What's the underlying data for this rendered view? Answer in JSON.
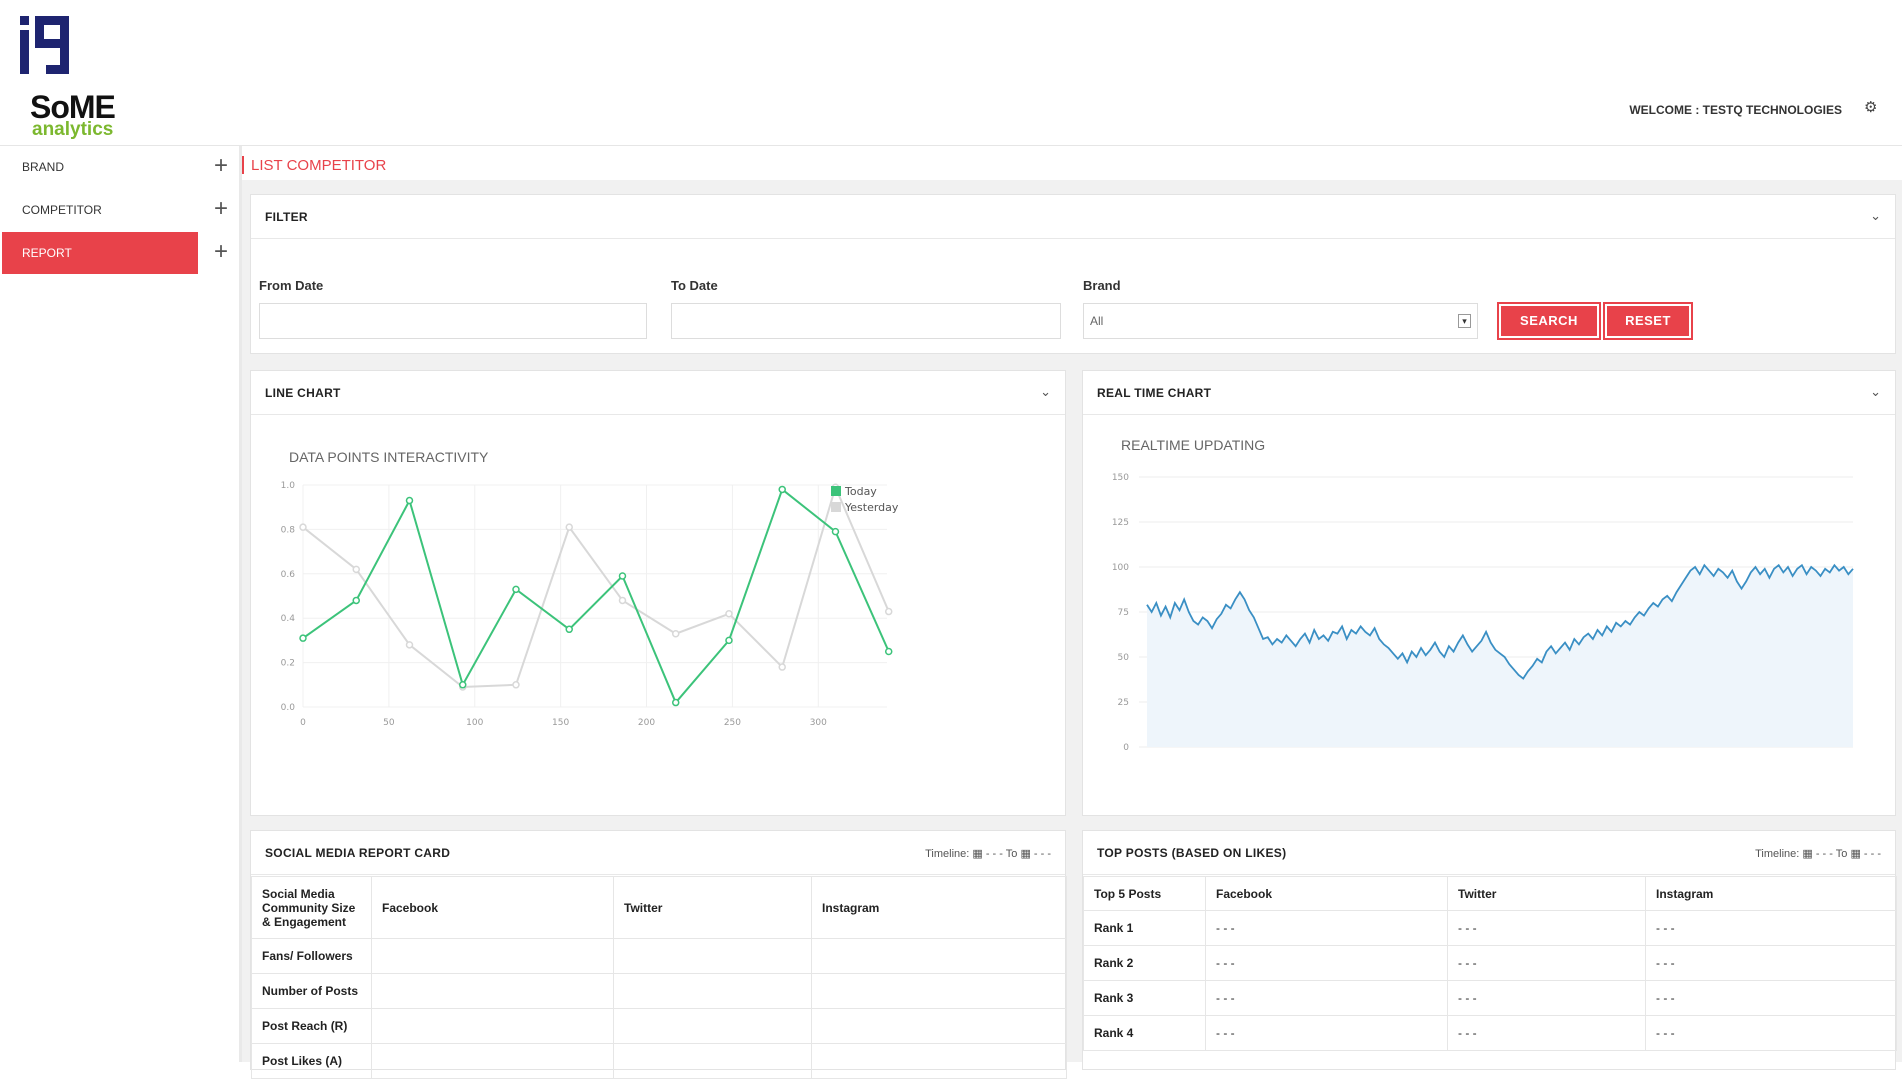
{
  "header": {
    "iq_logo": "iq",
    "brand_logo": {
      "word": "SoME",
      "sub": "analytics"
    },
    "welcome": "WELCOME : TESTQ TECHNOLOGIES",
    "settings_icon": "gear-icon"
  },
  "sidebar": {
    "items": [
      {
        "label": "BRAND"
      },
      {
        "label": "COMPETITOR"
      },
      {
        "label": "REPORT"
      }
    ]
  },
  "breadcrumb": {
    "label": "LIST COMPETITOR"
  },
  "filter": {
    "title": "FILTER",
    "from_label": "From Date",
    "from_value": "",
    "to_label": "To Date",
    "to_value": "",
    "brand_label": "Brand",
    "brand_value": "All",
    "search_label": "SEARCH",
    "reset_label": "RESET"
  },
  "line_panel": {
    "title": "LINE CHART"
  },
  "realtime_panel": {
    "title": "REAL TIME CHART"
  },
  "chart_data": [
    {
      "type": "line",
      "title": "DATA POINTS INTERACTIVITY",
      "xlim": [
        0,
        340
      ],
      "ylim": [
        0,
        1.0
      ],
      "xticks": [
        "0",
        "50",
        "100",
        "150",
        "200",
        "250",
        "300"
      ],
      "yticks": [
        "0.0",
        "0.2",
        "0.4",
        "0.6",
        "0.8",
        "1.0"
      ],
      "legend_position": "top-right",
      "series": [
        {
          "name": "Today",
          "color": "#3cc37a",
          "x": [
            0,
            31,
            62,
            93,
            124,
            155,
            186,
            217,
            248,
            279,
            310,
            341
          ],
          "values": [
            0.31,
            0.48,
            0.93,
            0.1,
            0.53,
            0.35,
            0.59,
            0.02,
            0.3,
            0.98,
            0.79,
            0.25
          ]
        },
        {
          "name": "Yesterday",
          "color": "#d8d8d8",
          "x": [
            0,
            31,
            62,
            93,
            124,
            155,
            186,
            217,
            248,
            279,
            310,
            341
          ],
          "values": [
            0.81,
            0.62,
            0.28,
            0.09,
            0.1,
            0.81,
            0.48,
            0.33,
            0.42,
            0.18,
            0.99,
            0.43
          ]
        }
      ]
    },
    {
      "type": "area",
      "title": "REALTIME UPDATING",
      "ylim": [
        0,
        150
      ],
      "yticks": [
        "0",
        "25",
        "50",
        "75",
        "100",
        "125",
        "150"
      ],
      "series": [
        {
          "name": "",
          "color": "#3a8fc4",
          "values": [
            79,
            75,
            80,
            73,
            78,
            72,
            80,
            76,
            82,
            75,
            70,
            68,
            72,
            70,
            66,
            71,
            74,
            79,
            77,
            82,
            86,
            82,
            76,
            72,
            66,
            60,
            61,
            57,
            60,
            58,
            62,
            59,
            56,
            60,
            63,
            58,
            65,
            60,
            62,
            59,
            64,
            63,
            67,
            60,
            65,
            63,
            67,
            64,
            62,
            66,
            60,
            57,
            55,
            52,
            49,
            52,
            47,
            53,
            50,
            55,
            51,
            54,
            58,
            53,
            50,
            56,
            53,
            58,
            62,
            57,
            53,
            56,
            59,
            64,
            58,
            54,
            52,
            50,
            46,
            43,
            40,
            38,
            42,
            45,
            49,
            47,
            53,
            56,
            52,
            55,
            58,
            54,
            60,
            57,
            61,
            63,
            60,
            65,
            62,
            67,
            64,
            69,
            67,
            70,
            68,
            72,
            75,
            73,
            77,
            80,
            78,
            82,
            84,
            81,
            86,
            90,
            94,
            98,
            100,
            96,
            101,
            98,
            95,
            99,
            97,
            94,
            98,
            92,
            88,
            92,
            97,
            100,
            96,
            99,
            94,
            99,
            101,
            97,
            100,
            95,
            99,
            101,
            96,
            100,
            98,
            95,
            99,
            97,
            101,
            98,
            100,
            96,
            99
          ]
        }
      ]
    }
  ],
  "report_card": {
    "title": "SOCIAL MEDIA REPORT CARD",
    "timeline": "Timeline: ▦ - - -  To  ▦ - - -",
    "headers": [
      "Social Media Community Size & Engagement",
      "Facebook",
      "Twitter",
      "Instagram"
    ],
    "rows": [
      {
        "label": "Fans/ Followers",
        "facebook": "",
        "twitter": "",
        "instagram": ""
      },
      {
        "label": "Number of Posts",
        "facebook": "",
        "twitter": "",
        "instagram": ""
      },
      {
        "label": "Post Reach (R)",
        "facebook": "",
        "twitter": "",
        "instagram": ""
      },
      {
        "label": "Post Likes (A)",
        "facebook": "",
        "twitter": "",
        "instagram": ""
      }
    ]
  },
  "top_posts": {
    "title": "TOP POSTS (BASED ON LIKES)",
    "timeline": "Timeline: ▦ - - -  To  ▦ - - -",
    "headers": [
      "Top 5 Posts",
      "Facebook",
      "Twitter",
      "Instagram"
    ],
    "rows": [
      {
        "label": "Rank 1",
        "facebook": "- - -",
        "twitter": "- - -",
        "instagram": "- - -"
      },
      {
        "label": "Rank 2",
        "facebook": "- - -",
        "twitter": "- - -",
        "instagram": "- - -"
      },
      {
        "label": "Rank 3",
        "facebook": "- - -",
        "twitter": "- - -",
        "instagram": "- - -"
      },
      {
        "label": "Rank 4",
        "facebook": "- - -",
        "twitter": "- - -",
        "instagram": "- - -"
      }
    ]
  }
}
